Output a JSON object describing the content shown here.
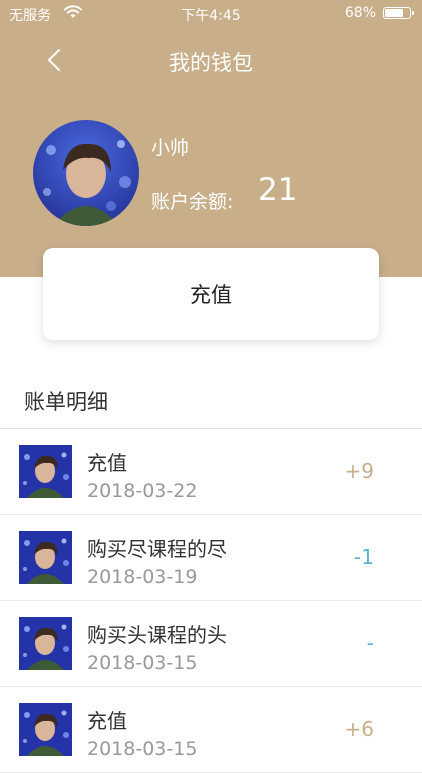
{
  "status_bar": {
    "carrier": "无服务",
    "time": "下午4:45",
    "battery_pct": "68%",
    "battery_level": 0.68
  },
  "nav": {
    "title": "我的钱包",
    "back_icon": "chevron-left-icon"
  },
  "profile": {
    "username": "小帅",
    "balance_label": "账户余额:",
    "balance": "21"
  },
  "recharge_button": "充值",
  "bills": {
    "title": "账单明细",
    "items": [
      {
        "name": "充值",
        "date": "2018-03-22",
        "amount": "+9",
        "type": "plus"
      },
      {
        "name": "购买尽课程的尽",
        "date": "2018-03-19",
        "amount": "-1",
        "type": "minus"
      },
      {
        "name": "购买头课程的头",
        "date": "2018-03-15",
        "amount": "-",
        "type": "minus"
      },
      {
        "name": "充值",
        "date": "2018-03-15",
        "amount": "+6",
        "type": "plus"
      }
    ]
  },
  "colors": {
    "header": "#c8ae89",
    "income": "#c8ae89",
    "expense": "#5ab4d0"
  }
}
